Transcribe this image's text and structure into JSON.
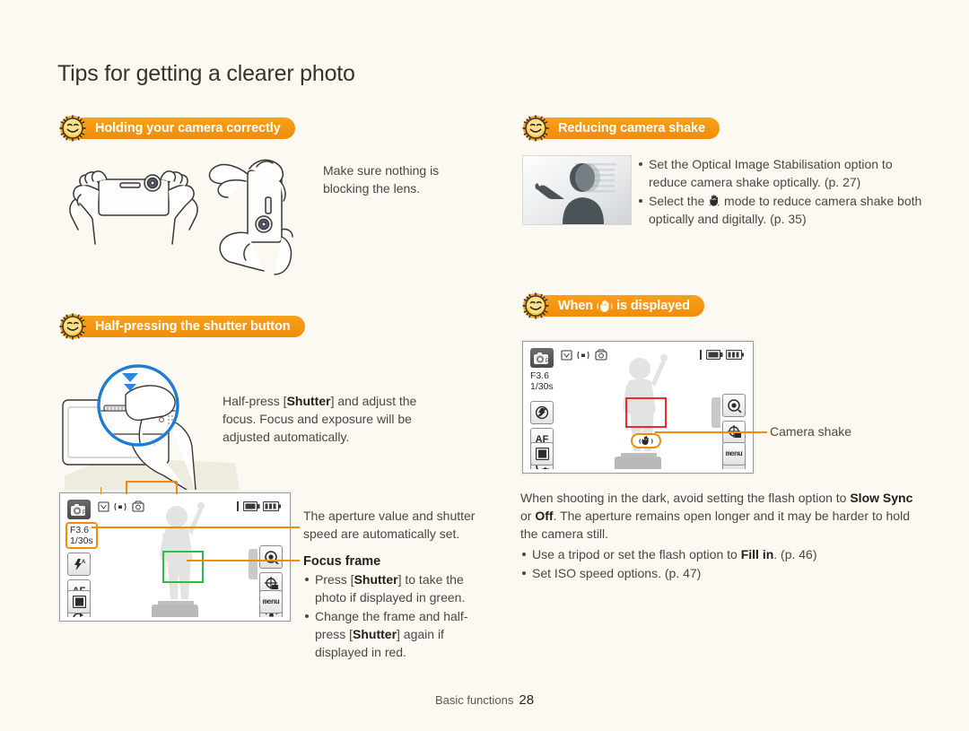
{
  "page": {
    "title": "Tips for getting a clearer photo",
    "background_color": "#FBF9F2",
    "accent_color": "#F08C0A",
    "footer_label": "Basic functions",
    "footer_page": "28"
  },
  "sections": {
    "holding": {
      "heading": "Holding your camera correctly",
      "note": "Make sure nothing is\nblocking the lens.",
      "note_line1": "Make sure nothing is",
      "note_line2": "blocking the lens.",
      "illustration_left": "hands-holding-camera-horizontal",
      "illustration_right": "hands-holding-camera-vertical"
    },
    "half_press": {
      "heading": "Half-pressing the shutter button",
      "body_line1_a": "Half-press [",
      "body_shutter": "Shutter",
      "body_line1_b": "] and adjust the",
      "body_line2": "focus. Focus and exposure will be",
      "body_line3": "adjusted automatically.",
      "illustration": "finger-half-pressing-shutter-magnified",
      "callout_aperture_line1": "The aperture value and shutter",
      "callout_aperture_line2": "speed are automatically set.",
      "callout_focus_title": "Focus frame",
      "callout_focus_bullets": [
        {
          "pre": "Press [",
          "strong": "Shutter",
          "post": "] to take the photo if displayed in green."
        },
        {
          "pre": "Change the frame and half-press [",
          "strong": "Shutter",
          "post": "] again if displayed in red."
        }
      ]
    },
    "reducing_shake": {
      "heading": "Reducing camera shake",
      "thumbnail": "motion-blurred-person-photo",
      "bullets": [
        {
          "pre": "Set the Optical Image Stabilisation option to reduce camera shake optically. (p. 27)",
          "icon": null,
          "post": null
        },
        {
          "pre": "Select the ",
          "icon": "shaky-hand-icon",
          "post": " mode to reduce camera shake both optically and digitally. (p. 35)"
        }
      ]
    },
    "when_displayed": {
      "heading_pre": "When ",
      "heading_icon": "shaky-hand-icon",
      "heading_post": " is displayed",
      "callout_label": "Camera shake",
      "body_pre": "When shooting in the dark, avoid setting the flash option to ",
      "body_strong1": "Slow Sync",
      "body_mid": " or ",
      "body_strong2": "Off",
      "body_post": ". The aperture remains open longer and it may be harder to hold the camera still.",
      "bullets": [
        {
          "pre": "Use a tripod or set the flash option to ",
          "strong": "Fill in",
          "post": ". (p. 46)"
        },
        {
          "pre": "Set ISO speed options. (p. 47)",
          "strong": null,
          "post": null
        }
      ]
    }
  },
  "lcd_left": {
    "name": "camera-lcd-green-focus",
    "mode_icon": "camera-mode-icon",
    "top_icons": [
      "face-detect-icon",
      "center-meter-icon",
      "scene-icon"
    ],
    "right_status_icons": [
      "memory-card-icon",
      "battery-icon"
    ],
    "aperture": "F3.6",
    "shutter_speed": "1/30s",
    "left_buttons": [
      "flash-auto",
      "AF",
      "timer-off",
      "display"
    ],
    "left_button_labels": [
      "⚡A",
      "AF",
      "↺OFF",
      "▣"
    ],
    "right_buttons": [
      "ois",
      "focus-area",
      "flash-mode",
      "menu"
    ],
    "menu_label": "menu",
    "focus_frame_color": "#2DBE46"
  },
  "lcd_right": {
    "name": "camera-lcd-red-focus-shake",
    "mode_icon": "camera-mode-icon",
    "top_icons": [
      "face-detect-icon",
      "center-meter-icon",
      "scene-icon"
    ],
    "right_status_icons": [
      "memory-card-icon",
      "battery-icon"
    ],
    "aperture": "F3.6",
    "shutter_speed": "1/30s",
    "left_buttons": [
      "flash-off",
      "AF",
      "timer-off",
      "display"
    ],
    "left_button_labels": [
      "⊘",
      "AF",
      "↺OFF",
      "▣"
    ],
    "right_buttons": [
      "ois",
      "focus-area",
      "flash-mode",
      "menu"
    ],
    "menu_label": "menu",
    "focus_frame_color": "#EF2B2B",
    "shake_badge_icon": "shake-warning-icon"
  }
}
